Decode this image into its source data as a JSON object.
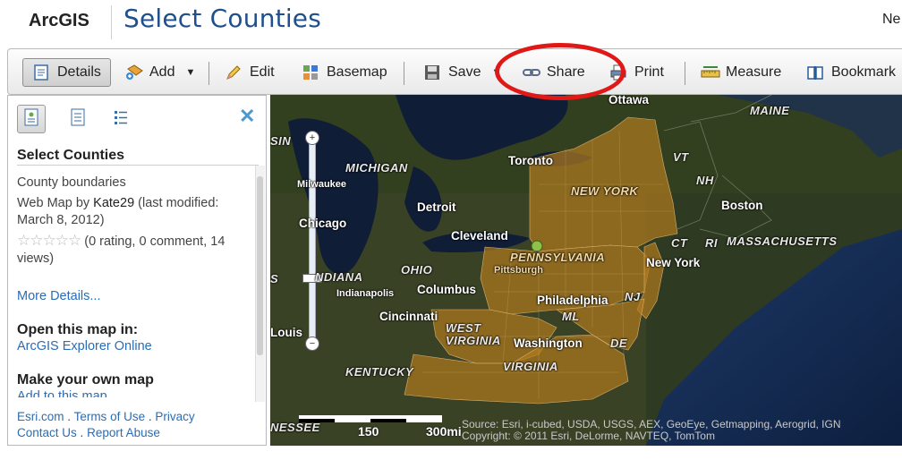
{
  "header": {
    "logo": "ArcGIS",
    "title": "Select Counties",
    "right_text": "Ne"
  },
  "toolbar": {
    "details": "Details",
    "add": "Add",
    "edit": "Edit",
    "basemap": "Basemap",
    "save": "Save",
    "share": "Share",
    "print": "Print",
    "measure": "Measure",
    "bookmarks": "Bookmark"
  },
  "panel": {
    "title": "Select Counties",
    "description": "County boundaries",
    "byline_prefix": "Web Map by ",
    "author": "Kate29",
    "byline_suffix": " (last modified: March 8, 2012)",
    "rating": "(0 rating, 0 comment, 14 views)",
    "more_details": "More Details...",
    "open_heading": "Open this map in:",
    "open_link": "ArcGIS Explorer Online",
    "make_heading": "Make your own map",
    "add_link": "Add to this map"
  },
  "footer": {
    "esri": "Esri.com",
    "terms": "Terms of Use",
    "privacy": "Privacy",
    "contact": "Contact Us",
    "abuse": "Report Abuse",
    "sep": "."
  },
  "map": {
    "labels": {
      "maine": "MAINE",
      "vt": "VT",
      "nh": "NH",
      "ma": "MASSACHUSETTS",
      "ct": "CT",
      "ri": "RI",
      "ny_state": "NEW YORK",
      "pa": "PENNSYLVANIA",
      "nj": "NJ",
      "md": "ML",
      "de": "DE",
      "wv": "WEST VIRGINIA",
      "va": "VIRGINIA",
      "ohio": "OHIO",
      "michigan": "MICHIGAN",
      "indiana": "NDIANA",
      "kentucky": "KENTUCKY",
      "tennessee": "NESSEE",
      "wisconsin": "SIN",
      "illinois": "S",
      "ottawa": "Ottawa",
      "toronto": "Toronto",
      "milwaukee": "Milwaukee",
      "detroit": "Detroit",
      "chicago": "Chicago",
      "cleveland": "Cleveland",
      "pittsburgh": "Pittsburgh",
      "boston": "Boston",
      "new_york": "New York",
      "philadelphia": "Philadelphia",
      "columbus": "Columbus",
      "indianapolis": "Indianapolis",
      "cincinnati": "Cincinnati",
      "washington": "Washington",
      "st_louis": "Louis"
    },
    "scale_150": "150",
    "scale_300": "300mi",
    "attribution_1": "Source: Esri, i-cubed, USDA, USGS, AEX, GeoEye, Getmapping, Aerogrid, IGN",
    "attribution_2": "Copyright: © 2011 Esri, DeLorme, NAVTEQ, TomTom"
  }
}
